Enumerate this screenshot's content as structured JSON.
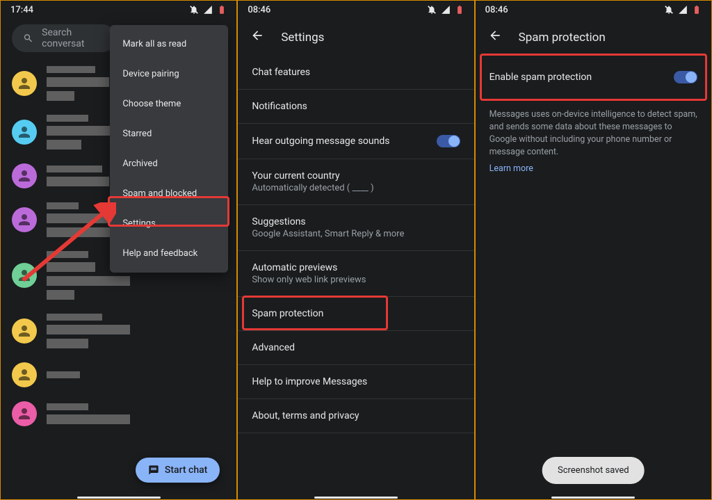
{
  "phone1": {
    "time": "17:44",
    "search_placeholder": "Search conversat",
    "menu": [
      "Mark all as read",
      "Device pairing",
      "Choose theme",
      "Starred",
      "Archived",
      "Spam and blocked",
      "Settings",
      "Help and feedback"
    ],
    "menu_highlight_index": 6,
    "fab_label": "Start chat",
    "avatars_colors": [
      "#f2c94c",
      "#56ccf2",
      "#bb6bd9",
      "#bb6bd9",
      "#6fcf97",
      "#f2c94c",
      "#f2c94c",
      "#eb5da7"
    ]
  },
  "phone2": {
    "time": "08:46",
    "title": "Settings",
    "items": [
      {
        "label": "Chat features"
      },
      {
        "label": "Notifications"
      },
      {
        "label": "Hear outgoing message sounds",
        "toggle": true
      },
      {
        "label": "Your current country",
        "sub": "Automatically detected ( ____ )"
      },
      {
        "label": "Suggestions",
        "sub": "Google Assistant, Smart Reply & more"
      },
      {
        "label": "Automatic previews",
        "sub": "Show only web link previews"
      },
      {
        "label": "Spam protection",
        "highlight": true
      },
      {
        "label": "Advanced"
      },
      {
        "label": "Help to improve Messages"
      },
      {
        "label": "About, terms and privacy"
      }
    ]
  },
  "phone3": {
    "time": "08:46",
    "title": "Spam protection",
    "enable_label": "Enable spam protection",
    "description": "Messages uses on-device intelligence to detect spam, and sends some data about these messages to Google without including your phone number or message content.",
    "learn_more": "Learn more",
    "toast": "Screenshot saved"
  }
}
